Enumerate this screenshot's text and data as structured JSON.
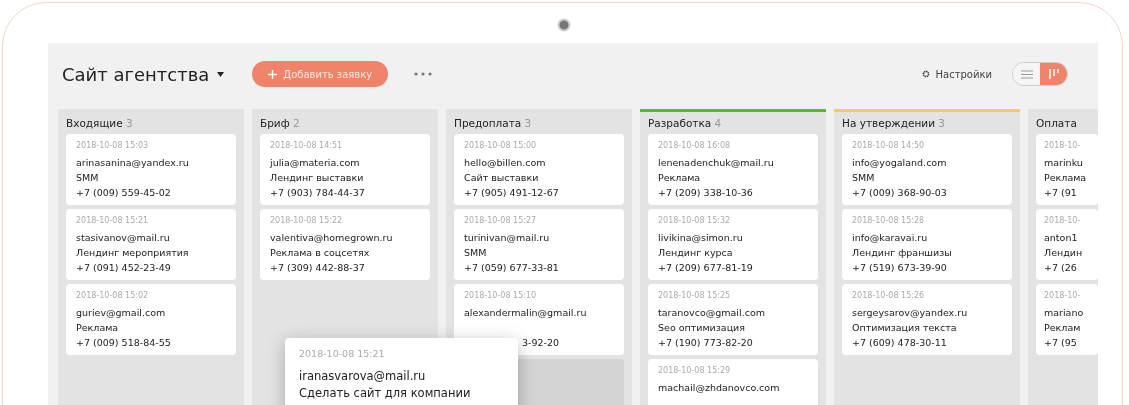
{
  "header": {
    "title": "Сайт агентства",
    "add_button": "Добавить заявку",
    "settings": "Настройки",
    "views": [
      {
        "kind": "list",
        "selected": false
      },
      {
        "kind": "board",
        "selected": true
      }
    ]
  },
  "columns": [
    {
      "title": "Входящие",
      "count": "3",
      "cards": [
        {
          "date": "2018-10-08 15:03",
          "email": "arinasanina@yandex.ru",
          "service": "SMM",
          "phone": "+7 (009) 559-45-02"
        },
        {
          "date": "2018-10-08 15:21",
          "email": "stasivanov@mail.ru",
          "service": "Лендинг мероприятия",
          "phone": "+7 (091) 452-23-49"
        },
        {
          "date": "2018-10-08 15:02",
          "email": "guriev@gmail.com",
          "service": "Реклама",
          "phone": "+7 (009) 518-84-55"
        }
      ]
    },
    {
      "title": "Бриф",
      "count": "2",
      "cards": [
        {
          "date": "2018-10-08 14:51",
          "email": "julia@materia.com",
          "service": "Лендинг выставки",
          "phone": "+7 (903) 784-44-37"
        },
        {
          "date": "2018-10-08 15:22",
          "email": "valentiva@homegrown.ru",
          "service": "Реклама в соцсетях",
          "phone": "+7 (309) 442-88-37"
        }
      ]
    },
    {
      "title": "Предоплата",
      "count": "3",
      "drop_target": true,
      "cards": [
        {
          "date": "2018-10-08 15:00",
          "email": "hello@billen.com",
          "service": "Сайт выставки",
          "phone": "+7 (905) 491-12-67"
        },
        {
          "date": "2018-10-08 15:27",
          "email": "turinivan@mail.ru",
          "service": "SMM",
          "phone": "+7 (059) 677-33-81"
        },
        {
          "date": "2018-10-08 15:10",
          "email": "alexandermalin@gmail.ru",
          "phone": "3-92-20",
          "partly_covered": true
        }
      ]
    },
    {
      "title": "Разработка",
      "count": "4",
      "color": "#5cb82a",
      "cards": [
        {
          "date": "2018-10-08 16:08",
          "email": "lenenadenchuk@mail.ru",
          "service": "Реклама",
          "phone": "+7 (209) 338-10-36"
        },
        {
          "date": "2018-10-08 15:32",
          "email": "livikina@simon.ru",
          "service": "Лендинг курса",
          "phone": "+7 (209) 677-81-19"
        },
        {
          "date": "2018-10-08 15:25",
          "email": "taranovco@gmail.com",
          "service": "Seo оптимизация",
          "phone": "+7 (190) 773-82-20"
        },
        {
          "date": "2018-10-08 15:29",
          "email": "machail@zhdanovco.com"
        }
      ]
    },
    {
      "title": "На утверждении",
      "count": "3",
      "color": "#f6c86e",
      "cards": [
        {
          "date": "2018-10-08 14:50",
          "email": "info@yogaland.com",
          "service": "SMM",
          "phone": "+7 (009) 368-90-03"
        },
        {
          "date": "2018-10-08 15:28",
          "email": "info@karavai.ru",
          "service": "Лендинг франшизы",
          "phone": "+7 (519) 673-39-90"
        },
        {
          "date": "2018-10-08 15:26",
          "email": "sergeysarov@yandex.ru",
          "service": "Оптимизация текста",
          "phone": "+7 (609) 478-30-11"
        }
      ]
    },
    {
      "title": "Оплата",
      "cards": [
        {
          "date": "2018-10-",
          "email": "marinku",
          "service": "Реклама",
          "phone": "+7 (91"
        },
        {
          "date": "2018-10-",
          "email": "anton1",
          "service": "Лендин",
          "phone": "+7 (26"
        },
        {
          "date": "2018-10-",
          "email": "mariano",
          "service": "Реклам",
          "phone": "+7 (95"
        }
      ]
    }
  ],
  "dragged_card": {
    "date": "2018-10-08 15:21",
    "email": "iranasvarova@mail.ru",
    "service": "Сделать сайт для компании"
  }
}
